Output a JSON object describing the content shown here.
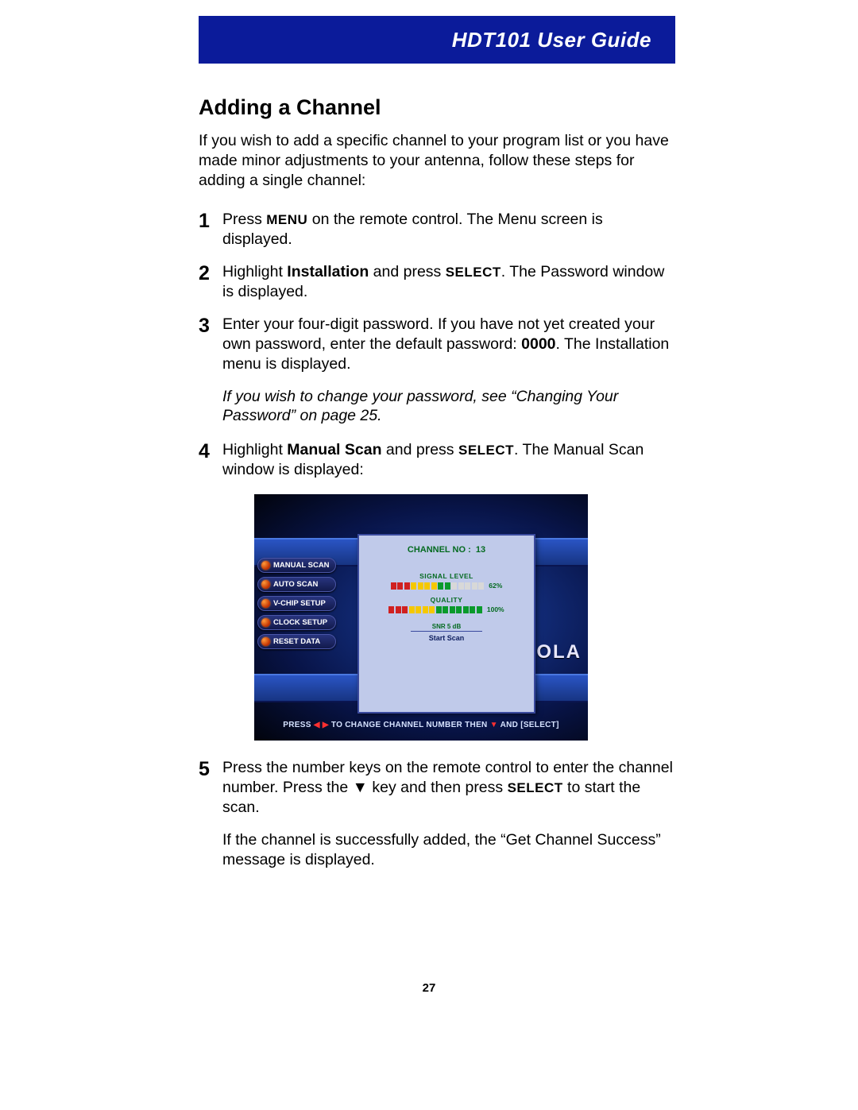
{
  "header": {
    "title": "HDT101 User Guide"
  },
  "page_number": "27",
  "section_title": "Adding a Channel",
  "intro": "If you wish to add a specific channel to your program list or you have made minor adjustments to your antenna, follow these steps for adding a single channel:",
  "steps": {
    "1": {
      "a": "Press ",
      "menu": "MENU",
      "b": " on the remote control. The Menu screen is displayed."
    },
    "2": {
      "a": "Highlight ",
      "bold": "Installation",
      "b": " and press ",
      "sel": "SELECT",
      "c": ". The Password window is displayed."
    },
    "3": {
      "a": "Enter your four-digit password. If you have not yet created your own password, enter the default password: ",
      "bold": "0000",
      "b": ". The Installation menu is displayed."
    },
    "note": "If you wish to change your password, see “Changing Your Password” on page 25.",
    "4": {
      "a": "Highlight ",
      "bold": "Manual Scan",
      "b": " and press ",
      "sel": "SELECT",
      "c": ". The Manual Scan window is displayed:"
    },
    "5": {
      "a": "Press the number keys on the remote control to enter the channel number. Press the ▼ key and then press ",
      "sel": "SELECT",
      "b": " to start the scan."
    },
    "post": "If the channel is successfully added, the “Get Channel Success” message is displayed."
  },
  "tv": {
    "menu": [
      "MANUAL SCAN",
      "AUTO SCAN",
      "V-CHIP SETUP",
      "CLOCK SETUP",
      "RESET DATA"
    ],
    "brand": "OLA",
    "channel_label": "CHANNEL NO :",
    "channel_no": "13",
    "signal_label": "SIGNAL LEVEL",
    "signal_pct": "62%",
    "quality_label": "QUALITY",
    "quality_pct": "100%",
    "snr": "SNR     5    dB",
    "start": "Start Scan",
    "hint_a": "PRESS ",
    "hint_b": " TO CHANGE CHANNEL NUMBER THEN ",
    "hint_c": " AND [SELECT]"
  }
}
